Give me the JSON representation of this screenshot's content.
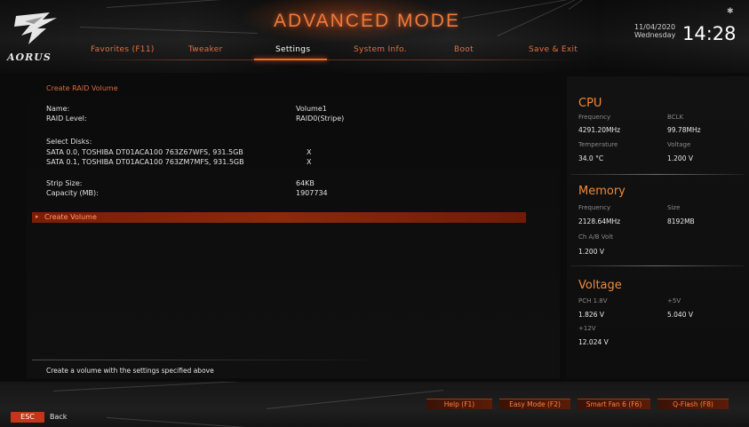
{
  "header": {
    "brand": "AORUS",
    "mode_title": "ADVANCED MODE",
    "tabs": [
      {
        "label": "Favorites (F11)",
        "active": false
      },
      {
        "label": "Tweaker",
        "active": false
      },
      {
        "label": "Settings",
        "active": true
      },
      {
        "label": "System Info.",
        "active": false
      },
      {
        "label": "Boot",
        "active": false
      },
      {
        "label": "Save & Exit",
        "active": false
      }
    ],
    "date": "11/04/2020",
    "weekday": "Wednesday",
    "time": "14:28",
    "accent_color": "#ff6a1a"
  },
  "main": {
    "section_title": "Create RAID Volume",
    "fields": {
      "name_label": "Name:",
      "name_value": "Volume1",
      "raid_label": "RAID Level:",
      "raid_value": "RAID0(Stripe)",
      "select_disks_label": "Select Disks:",
      "disk1_label": "SATA 0.0, TOSHIBA DT01ACA100 763Z67WFS, 931.5GB",
      "disk1_value": "X",
      "disk2_label": "SATA 0.1, TOSHIBA DT01ACA100 763ZM7MFS, 931.5GB",
      "disk2_value": "X",
      "strip_label": "Strip Size:",
      "strip_value": "64KB",
      "capacity_label": "Capacity (MB):",
      "capacity_value": "1907734"
    },
    "selected_item": "Create Volume",
    "help_text": "Create a volume with the settings specified above"
  },
  "side": {
    "cpu": {
      "title": "CPU",
      "freq_label": "Frequency",
      "freq_value": "4291.20MHz",
      "bclk_label": "BCLK",
      "bclk_value": "99.78MHz",
      "temp_label": "Temperature",
      "temp_value": "34.0 °C",
      "volt_label": "Voltage",
      "volt_value": "1.200 V"
    },
    "memory": {
      "title": "Memory",
      "freq_label": "Frequency",
      "freq_value": "2128.64MHz",
      "size_label": "Size",
      "size_value": "8192MB",
      "chab_label": "Ch A/B Volt",
      "chab_value": "1.200 V"
    },
    "voltage": {
      "title": "Voltage",
      "pch_label": "PCH 1.8V",
      "pch_value": "1.826 V",
      "p5_label": "+5V",
      "p5_value": "5.040 V",
      "p12_label": "+12V",
      "p12_value": "12.024 V"
    }
  },
  "footer": {
    "buttons": [
      "Help (F1)",
      "Easy Mode (F2)",
      "Smart Fan 6 (F6)",
      "Q-Flash (F8)"
    ],
    "esc_label": "ESC",
    "back_label": "Back"
  }
}
